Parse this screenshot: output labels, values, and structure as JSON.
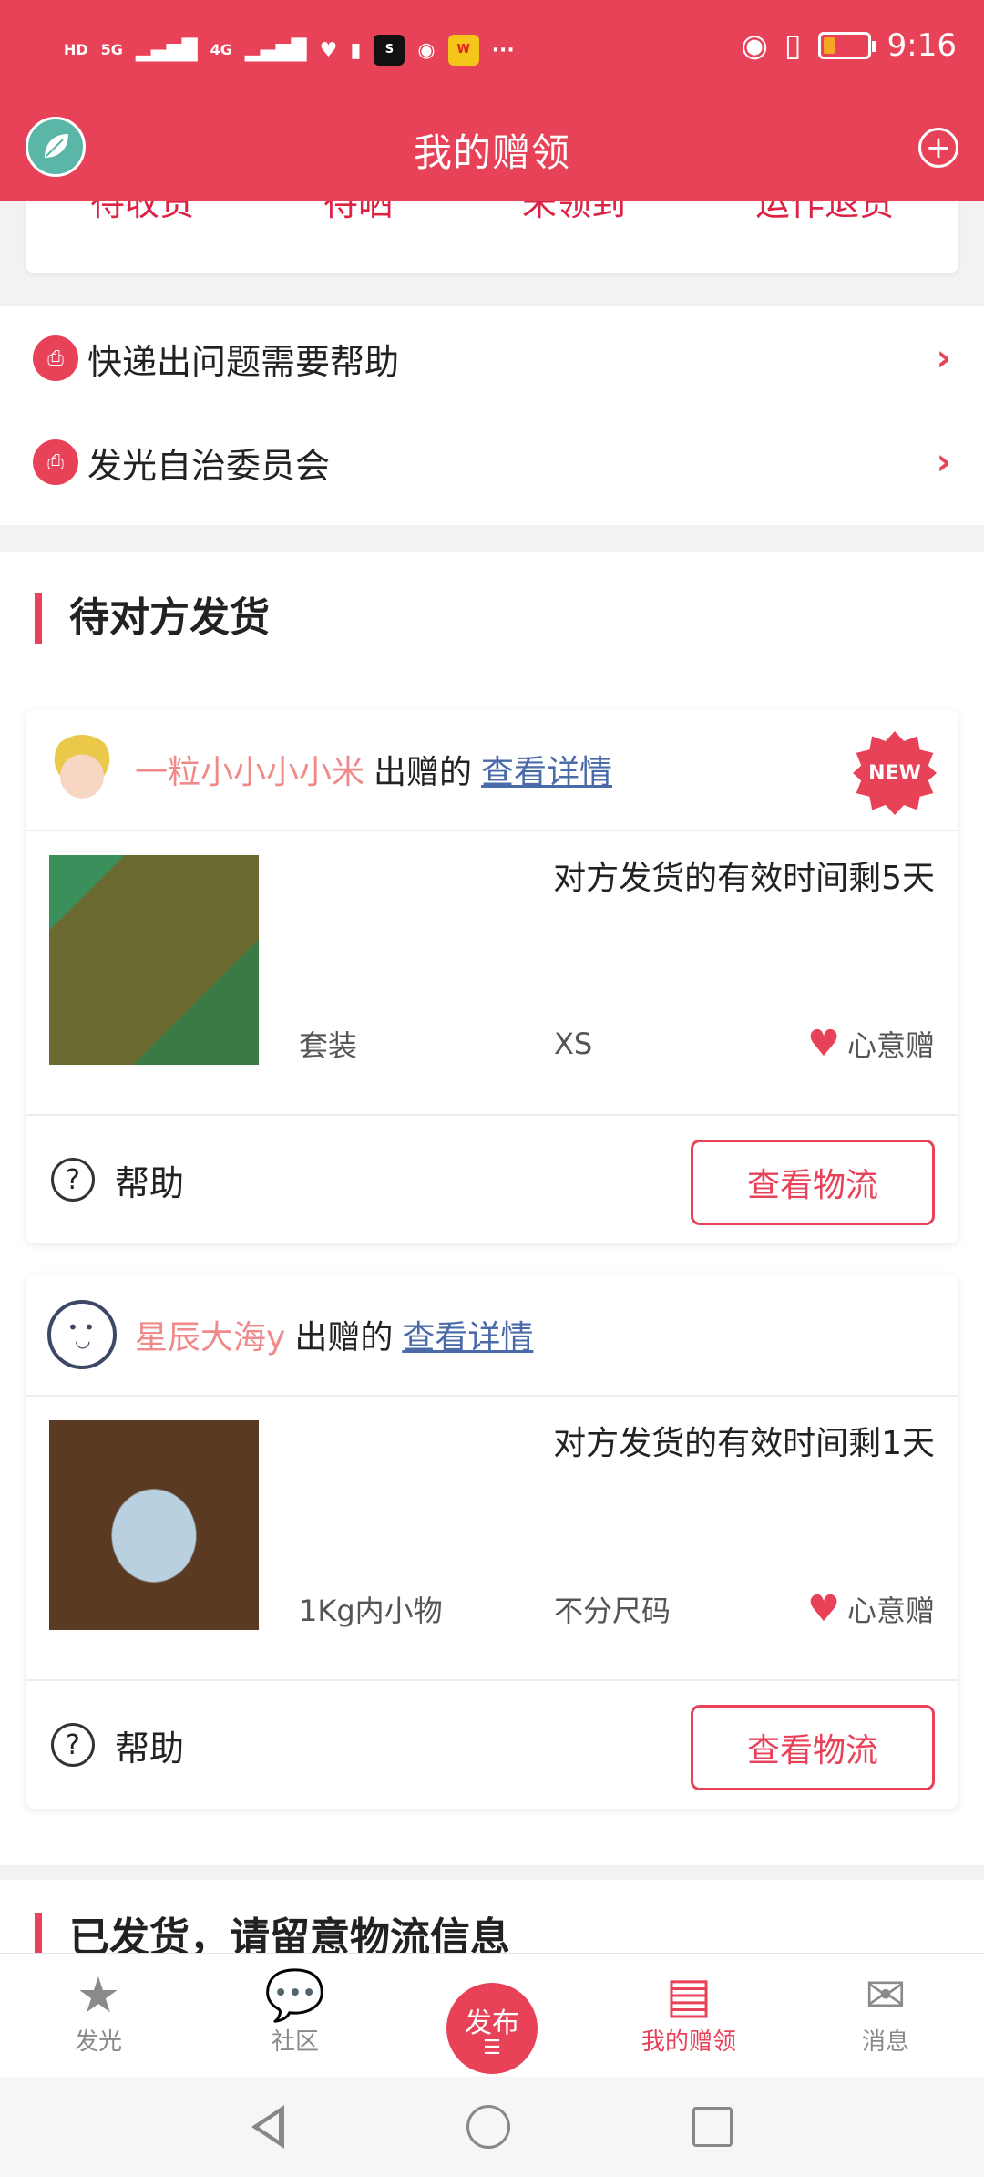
{
  "status_bar": {
    "time": "9:16",
    "left_labels": [
      "HD",
      "5G",
      "4G"
    ],
    "battery_level": 0.25
  },
  "header": {
    "title": "我的赠领"
  },
  "top_card": {
    "tabs": [
      "待收货",
      "待晒",
      "未领到",
      "运作退货"
    ]
  },
  "help_links": [
    {
      "label": "快递出问题需要帮助"
    },
    {
      "label": "发光自治委员会"
    }
  ],
  "section": {
    "title": "待对方发货"
  },
  "orders": [
    {
      "user": "一粒小小小小米",
      "given_text": "出赠的",
      "detail_link": "查看详情",
      "is_new": true,
      "new_label": "NEW",
      "deadline": "对方发货的有效时间剩5天",
      "category": "套装",
      "size": "XS",
      "type": "心意赠",
      "help": "帮助",
      "logistics": "查看物流"
    },
    {
      "user": "星辰大海y",
      "given_text": "出赠的",
      "detail_link": "查看详情",
      "is_new": false,
      "deadline": "对方发货的有效时间剩1天",
      "category": "1Kg内小物",
      "size": "不分尺码",
      "type": "心意赠",
      "help": "帮助",
      "logistics": "查看物流"
    }
  ],
  "section2": {
    "title": "已发货，请留意物流信息"
  },
  "tabbar": [
    {
      "label": "发光",
      "icon": "star-icon"
    },
    {
      "label": "社区",
      "icon": "chat-icon"
    },
    {
      "label": "发布",
      "icon": "publish-icon"
    },
    {
      "label": "我的赠领",
      "icon": "box-icon",
      "active": true
    },
    {
      "label": "消息",
      "icon": "mail-icon"
    }
  ]
}
